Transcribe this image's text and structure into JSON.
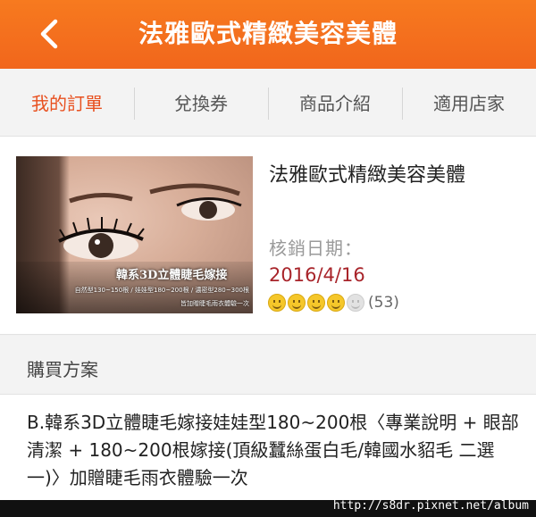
{
  "header": {
    "title": "法雅歐式精緻美容美體",
    "back_icon": "chevron-left-icon"
  },
  "tabs": [
    {
      "label": "我的訂單",
      "active": true
    },
    {
      "label": "兌換券",
      "active": false
    },
    {
      "label": "商品介紹",
      "active": false
    },
    {
      "label": "適用店家",
      "active": false
    }
  ],
  "order": {
    "thumbnail": {
      "brand": "韓系3D立體睫毛嫁接",
      "line1": "自然型130~150根 / 娃娃型180~200根 / 濃密型280~300根",
      "line2": "皆加贈睫毛雨衣體驗一次"
    },
    "store_name": "法雅歐式精緻美容美體",
    "expire_label": "核銷日期：",
    "expire_date": "2016/4/16",
    "rating": {
      "score": 4,
      "max": 5,
      "count": "(53)"
    }
  },
  "plan": {
    "header": "購買方案",
    "description": "B.韓系3D立體睫毛嫁接娃娃型180~200根〈專業說明 + 眼部清潔 + 180~200根嫁接(頂級蠶絲蛋白毛/韓國水貂毛 二選一)〉加贈睫毛雨衣體驗一次"
  },
  "watermark": "http://s8dr.pixnet.net/album",
  "colors": {
    "accent": "#f1661c",
    "active_tab": "#e8501f",
    "date": "#a8242a"
  }
}
